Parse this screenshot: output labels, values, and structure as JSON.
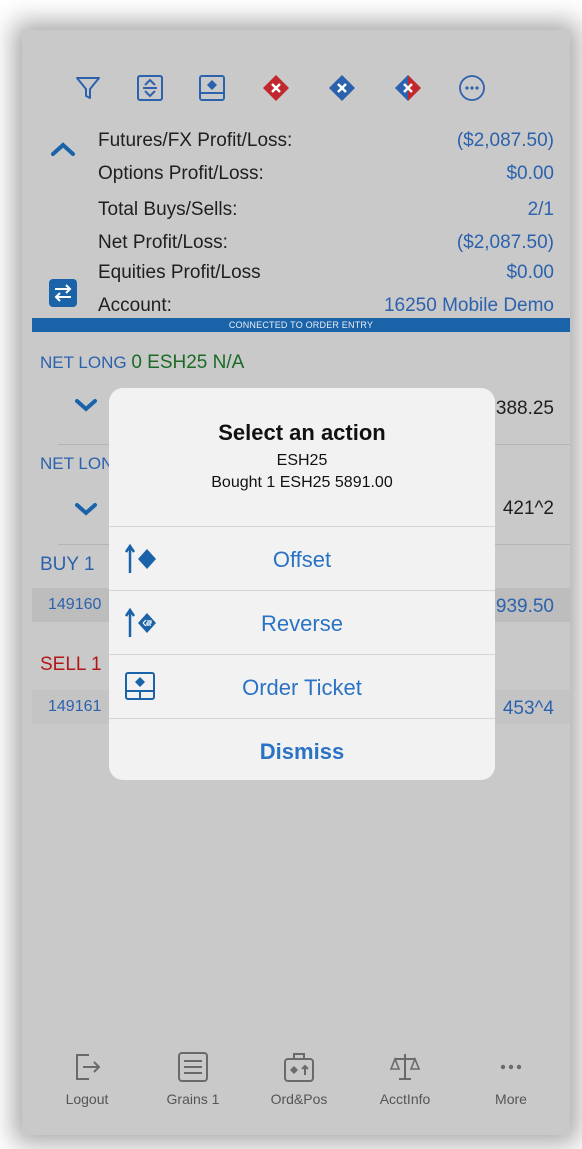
{
  "toolbar": {
    "icons": [
      "filter-icon",
      "expand-collapse-icon",
      "order-ticket-icon",
      "cancel-all-icon",
      "cancel-buys-icon",
      "cancel-sells-icon",
      "more-circle-icon"
    ]
  },
  "summary": {
    "futures_label": "Futures/FX Profit/Loss:",
    "futures_value": "($2,087.50)",
    "options_label": "Options Profit/Loss:",
    "options_value": "$0.00",
    "buys_label": "Total Buys/Sells:",
    "buys_value": "2/1",
    "net_label": "Net Profit/Loss:",
    "net_value": "($2,087.50)",
    "equities_label": "Equities Profit/Loss",
    "equities_value": "$0.00",
    "account_label": "Account:",
    "account_value": "16250 Mobile Demo"
  },
  "connection": {
    "status": "CONNECTED TO ORDER ENTRY"
  },
  "positions": {
    "row1_label": "NET LONG",
    "row1_detail": "0 ESH25 N/A",
    "row1_value": "388.25",
    "row2_label": "NET LON",
    "row2_value": "421^2",
    "buy_label": "BUY 1",
    "buy_id": "149160",
    "buy_value": "939.50",
    "sell_label": "SELL 1",
    "sell_id": "149161",
    "sell_value": "453^4"
  },
  "dialog": {
    "title": "Select an action",
    "symbol": "ESH25",
    "detail": "Bought 1 ESH25 5891.00",
    "offset_label": "Offset",
    "reverse_label": "Reverse",
    "ticket_label": "Order Ticket",
    "dismiss_label": "Dismiss"
  },
  "tabs": {
    "logout": "Logout",
    "grains": "Grains 1",
    "ordpos": "Ord&Pos",
    "acctinfo": "AcctInfo",
    "more": "More"
  },
  "colors": {
    "accent_blue": "#2c62ad",
    "connection_bar": "#1b63a8",
    "sell_red": "#b01818",
    "long_green": "#1a6b23",
    "dialog_blue": "#2a73c4"
  }
}
